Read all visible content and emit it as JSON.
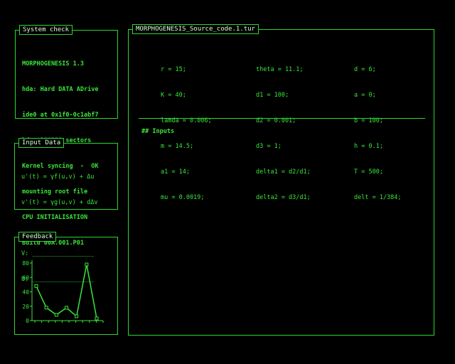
{
  "system_check": {
    "title": "System check",
    "lines": [
      "MORPHOGENESIS 1.3",
      "hda: Hard DATA ADrive",
      "ide0 at 0x1f0-0c1abf7",
      "hda: 180228 sectors",
      "Kernel syncing  -  OK",
      "mounting root file",
      "CPU INITIALISATION",
      "Build 00A.001.P01"
    ]
  },
  "input_data": {
    "title": "Input Data",
    "eq1": "u'(t) = γf(u,v) + Δu",
    "eq2": "v'(t) = γg(u,v) + dΔv",
    "v_field": "V: _________________",
    "u_field": "U: _________________"
  },
  "feedback": {
    "title": "Feedback",
    "colors": {
      "line": "#39e639",
      "axis": "#39e639"
    },
    "chart_data": {
      "type": "line",
      "x": [
        1,
        2,
        3,
        4,
        5,
        6,
        7
      ],
      "series": [
        {
          "values": [
            48,
            18,
            8,
            18,
            6,
            78,
            3
          ]
        }
      ],
      "yticks": [
        "80",
        "60",
        "40",
        "20",
        "0"
      ],
      "ylim": [
        0,
        80
      ]
    }
  },
  "source": {
    "title": "MORPHOGENESIS_Source_code.1.tur",
    "col1": [
      "r = 15;",
      "K = 40;",
      "lamda = 0.006;",
      "m = 14.5;",
      "a1 = 14;",
      "mu = 0.0019;"
    ],
    "col2": [
      "theta = 11.1;",
      "d1 = 100;",
      "d2 = 0.001;",
      "d3 = 1;",
      "delta1 = d2/d1;",
      "delta2 = d3/d1;"
    ],
    "col3": [
      "d = 6;",
      "a = 0;",
      "b = 100;",
      "h = 0.1;",
      "T = 500;",
      "delt = 1/384;"
    ],
    "section": "## Inputs"
  }
}
